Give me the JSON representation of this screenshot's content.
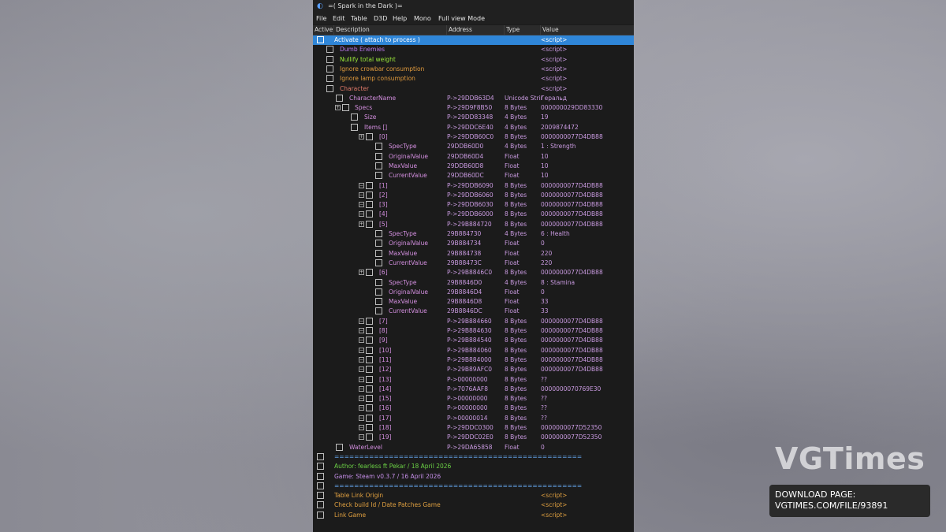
{
  "window": {
    "title": "=( Spark in the Dark )="
  },
  "menu": [
    "File",
    "Edit",
    "Table",
    "D3D",
    "Help",
    "Mono",
    "Full view Mode"
  ],
  "columns": [
    "Active",
    "Description",
    "Address",
    "Type",
    "Value"
  ],
  "rows": [
    {
      "desc": "Activate ( attach to process )",
      "addr": "",
      "type": "",
      "val": "<script>"
    },
    {
      "desc": "Dumb Enemies",
      "addr": "",
      "type": "",
      "val": "<script>"
    },
    {
      "desc": "Nullify total weight",
      "addr": "",
      "type": "",
      "val": "<script>"
    },
    {
      "desc": "Ignore crowbar consumption",
      "addr": "",
      "type": "",
      "val": "<script>"
    },
    {
      "desc": "Ignore lamp consumption",
      "addr": "",
      "type": "",
      "val": "<script>"
    },
    {
      "desc": "Character",
      "addr": "",
      "type": "",
      "val": "<script>"
    },
    {
      "desc": "CharacterName",
      "addr": "P->29DDB63D4",
      "type": "Unicode Strir",
      "val": "Геральд"
    },
    {
      "desc": "Specs",
      "addr": "P->29D9F8B50",
      "type": "8 Bytes",
      "val": "000000029DD83330"
    },
    {
      "desc": "Size",
      "addr": "P->29DD83348",
      "type": "4 Bytes",
      "val": "19"
    },
    {
      "desc": "Items []",
      "addr": "P->29DDC6E40",
      "type": "4 Bytes",
      "val": "2009874472"
    },
    {
      "desc": "[0]",
      "addr": "P->29DDB60C0",
      "type": "8 Bytes",
      "val": "0000000077D4DB88"
    },
    {
      "desc": "SpecType",
      "addr": "29DDB60D0",
      "type": "4 Bytes",
      "val": "1 : Strength"
    },
    {
      "desc": "OriginalValue",
      "addr": "29DDB60D4",
      "type": "Float",
      "val": "10"
    },
    {
      "desc": "MaxValue",
      "addr": "29DDB60D8",
      "type": "Float",
      "val": "10"
    },
    {
      "desc": "CurrentValue",
      "addr": "29DDB60DC",
      "type": "Float",
      "val": "10"
    },
    {
      "desc": "[1]",
      "addr": "P->29DDB6090",
      "type": "8 Bytes",
      "val": "0000000077D4DB88"
    },
    {
      "desc": "[2]",
      "addr": "P->29DDB6060",
      "type": "8 Bytes",
      "val": "0000000077D4DB88"
    },
    {
      "desc": "[3]",
      "addr": "P->29DDB6030",
      "type": "8 Bytes",
      "val": "0000000077D4DB88"
    },
    {
      "desc": "[4]",
      "addr": "P->29DDB6000",
      "type": "8 Bytes",
      "val": "0000000077D4DB88"
    },
    {
      "desc": "[5]",
      "addr": "P->29B884720",
      "type": "8 Bytes",
      "val": "0000000077D4DB88"
    },
    {
      "desc": "SpecType",
      "addr": "29B884730",
      "type": "4 Bytes",
      "val": "6 : Health"
    },
    {
      "desc": "OriginalValue",
      "addr": "29B884734",
      "type": "Float",
      "val": "0"
    },
    {
      "desc": "MaxValue",
      "addr": "29B884738",
      "type": "Float",
      "val": "220"
    },
    {
      "desc": "CurrentValue",
      "addr": "29B88473C",
      "type": "Float",
      "val": "220"
    },
    {
      "desc": "[6]",
      "addr": "P->29B8846C0",
      "type": "8 Bytes",
      "val": "0000000077D4DB88"
    },
    {
      "desc": "SpecType",
      "addr": "29B8846D0",
      "type": "4 Bytes",
      "val": "8 : Stamina"
    },
    {
      "desc": "OriginalValue",
      "addr": "29B8846D4",
      "type": "Float",
      "val": "0"
    },
    {
      "desc": "MaxValue",
      "addr": "29B8846D8",
      "type": "Float",
      "val": "33"
    },
    {
      "desc": "CurrentValue",
      "addr": "29B8846DC",
      "type": "Float",
      "val": "33"
    },
    {
      "desc": "[7]",
      "addr": "P->29B884660",
      "type": "8 Bytes",
      "val": "0000000077D4DB88"
    },
    {
      "desc": "[8]",
      "addr": "P->29B884630",
      "type": "8 Bytes",
      "val": "0000000077D4DB88"
    },
    {
      "desc": "[9]",
      "addr": "P->29B884540",
      "type": "8 Bytes",
      "val": "0000000077D4DB88"
    },
    {
      "desc": "[10]",
      "addr": "P->29B884060",
      "type": "8 Bytes",
      "val": "0000000077D4DB88"
    },
    {
      "desc": "[11]",
      "addr": "P->29B884000",
      "type": "8 Bytes",
      "val": "0000000077D4DB88"
    },
    {
      "desc": "[12]",
      "addr": "P->29B89AFC0",
      "type": "8 Bytes",
      "val": "0000000077D4DB88"
    },
    {
      "desc": "[13]",
      "addr": "P->00000000",
      "type": "8 Bytes",
      "val": "??"
    },
    {
      "desc": "[14]",
      "addr": "P->7076AAF8",
      "type": "8 Bytes",
      "val": "0000000070769E30"
    },
    {
      "desc": "[15]",
      "addr": "P->00000000",
      "type": "8 Bytes",
      "val": "??"
    },
    {
      "desc": "[16]",
      "addr": "P->00000000",
      "type": "8 Bytes",
      "val": "??"
    },
    {
      "desc": "[17]",
      "addr": "P->00000014",
      "type": "8 Bytes",
      "val": "??"
    },
    {
      "desc": "[18]",
      "addr": "P->29DDC0300",
      "type": "8 Bytes",
      "val": "0000000077D52350"
    },
    {
      "desc": "[19]",
      "addr": "P->29DDC02E0",
      "type": "8 Bytes",
      "val": "0000000077D52350"
    },
    {
      "desc": "WaterLevel",
      "addr": "P->29DA65858",
      "type": "Float",
      "val": "0"
    },
    {
      "desc": "==================================================",
      "addr": "",
      "type": "",
      "val": ""
    },
    {
      "desc": "Author: fearless ft Pekar / 18 April 2026",
      "addr": "",
      "type": "",
      "val": ""
    },
    {
      "desc": "Game: Steam v0.3.7 / 16 April 2026",
      "addr": "",
      "type": "",
      "val": ""
    },
    {
      "desc": "==================================================",
      "addr": "",
      "type": "",
      "val": ""
    },
    {
      "desc": "Table Link Origin",
      "addr": "",
      "type": "",
      "val": "<script>"
    },
    {
      "desc": "Check build Id / Date Patches Game",
      "addr": "",
      "type": "",
      "val": "<script>"
    },
    {
      "desc": "Link Game",
      "addr": "",
      "type": "",
      "val": "<script>"
    }
  ],
  "watermark": {
    "text": "VGTimes"
  },
  "download": {
    "line1": "DOWNLOAD PAGE:",
    "line2": "VGTIMES.COM/FILE/93891"
  }
}
